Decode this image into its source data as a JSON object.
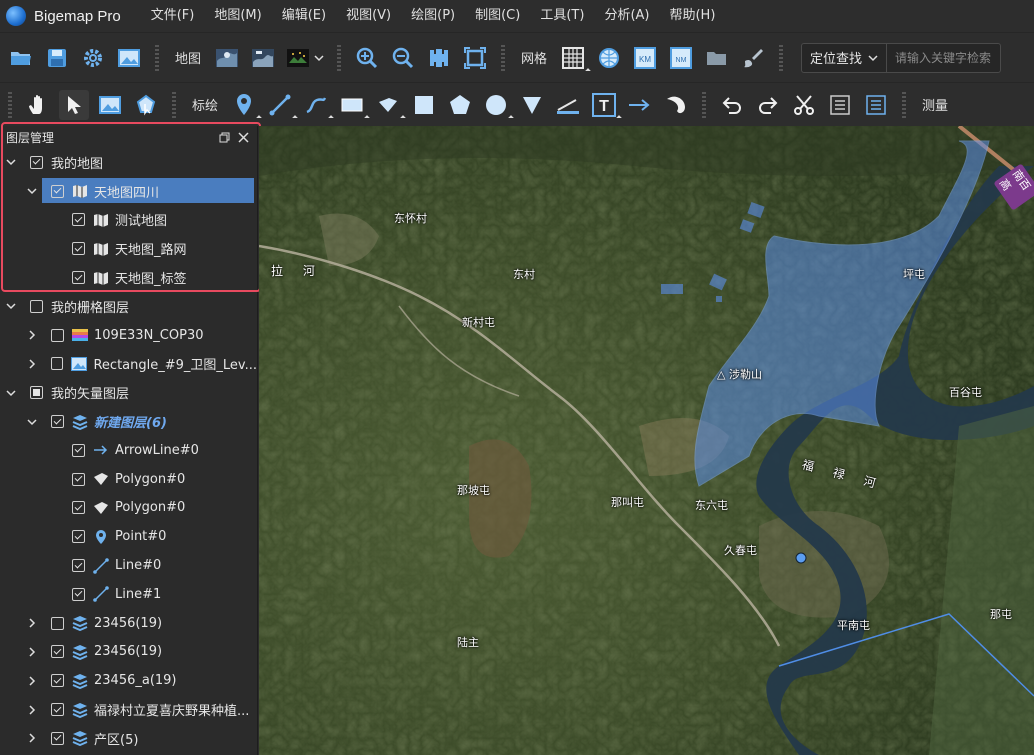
{
  "app": {
    "title": "Bigemap Pro"
  },
  "menu": [
    "文件(F)",
    "地图(M)",
    "编辑(E)",
    "视图(V)",
    "绘图(P)",
    "制图(C)",
    "工具(T)",
    "分析(A)",
    "帮助(H)"
  ],
  "toolbar1": {
    "map_label": "地图",
    "grid_label": "网格",
    "search": {
      "mode": "定位查找",
      "placeholder": "请输入关键字检索"
    },
    "icons": [
      "open-folder-icon",
      "save-icon",
      "settings-gear-icon",
      "image-export-icon",
      "map-source-1-icon",
      "map-source-2-icon",
      "map-source-3-icon",
      "zoom-in-icon",
      "zoom-out-icon",
      "zoom-extent-icon",
      "full-extent-icon",
      "grid-icon",
      "utm-grid-icon",
      "km-grid-icon",
      "nm-grid-icon",
      "folder-gray-icon",
      "brush-icon"
    ]
  },
  "toolbar2": {
    "annotate_label": "标绘",
    "measure_label": "测量",
    "icons": [
      "pan-hand-icon",
      "select-arrow-icon",
      "image-select-icon",
      "polygon-select-icon",
      "marker-icon",
      "line-icon",
      "curve-icon",
      "rectangle-icon",
      "polygon-icon",
      "square-icon",
      "pentagon-icon",
      "circle-icon",
      "triangle-icon",
      "ruler-icon",
      "text-icon",
      "arrow-icon",
      "cut-shape-icon",
      "undo-icon",
      "redo-icon",
      "scissors-icon",
      "properties-icon",
      "list-icon"
    ]
  },
  "panel": {
    "title": "图层管理",
    "rows": [
      {
        "label": "我的地图",
        "indent": 0,
        "chevron": "down",
        "check": "checked",
        "icon": "none"
      },
      {
        "label": "天地图四川",
        "indent": 1,
        "chevron": "down",
        "check": "checked",
        "icon": "map",
        "selected": true
      },
      {
        "label": "测试地图",
        "indent": 2,
        "chevron": "none",
        "check": "checked",
        "icon": "map"
      },
      {
        "label": "天地图_路网",
        "indent": 2,
        "chevron": "none",
        "check": "checked",
        "icon": "map"
      },
      {
        "label": "天地图_标签",
        "indent": 2,
        "chevron": "none",
        "check": "checked",
        "icon": "map"
      },
      {
        "label": "我的栅格图层",
        "indent": 0,
        "chevron": "down",
        "check": "unchecked",
        "icon": "none"
      },
      {
        "label": "109E33N_COP30",
        "indent": 1,
        "chevron": "right",
        "check": "unchecked",
        "icon": "rainbow"
      },
      {
        "label": "Rectangle_#9_卫图_Lev...",
        "indent": 1,
        "chevron": "right",
        "check": "unchecked",
        "icon": "image"
      },
      {
        "label": "我的矢量图层",
        "indent": 0,
        "chevron": "down",
        "check": "partial",
        "icon": "none"
      },
      {
        "label": "新建图层(6)",
        "indent": 1,
        "chevron": "down",
        "check": "checked",
        "icon": "layers",
        "italic": true
      },
      {
        "label": "ArrowLine#0",
        "indent": 2,
        "chevron": "none",
        "check": "checked",
        "icon": "arrow"
      },
      {
        "label": "Polygon#0",
        "indent": 2,
        "chevron": "none",
        "check": "checked",
        "icon": "polygon"
      },
      {
        "label": "Polygon#0",
        "indent": 2,
        "chevron": "none",
        "check": "checked",
        "icon": "polygon"
      },
      {
        "label": "Point#0",
        "indent": 2,
        "chevron": "none",
        "check": "checked",
        "icon": "point"
      },
      {
        "label": "Line#0",
        "indent": 2,
        "chevron": "none",
        "check": "checked",
        "icon": "line"
      },
      {
        "label": "Line#1",
        "indent": 2,
        "chevron": "none",
        "check": "checked",
        "icon": "line"
      },
      {
        "label": "23456(19)",
        "indent": 1,
        "chevron": "right",
        "check": "unchecked",
        "icon": "layers"
      },
      {
        "label": "23456(19)",
        "indent": 1,
        "chevron": "right",
        "check": "checked",
        "icon": "layers"
      },
      {
        "label": "23456_a(19)",
        "indent": 1,
        "chevron": "right",
        "check": "checked",
        "icon": "layers"
      },
      {
        "label": "福禄村立夏喜庆野果种植...",
        "indent": 1,
        "chevron": "right",
        "check": "checked",
        "icon": "layers"
      },
      {
        "label": "产区(5)",
        "indent": 1,
        "chevron": "right",
        "check": "checked",
        "icon": "layers"
      }
    ]
  },
  "map": {
    "labels": {
      "dongwai": "东怀村",
      "donghui": "东村",
      "xincun": "新村屯",
      "lahe": "拉  河",
      "shelei": "△ 涉勒山",
      "fulu": "福 禄 河",
      "nashan": "那坡屯",
      "najiao": "那叫屯",
      "dongliu": "东六屯",
      "jiuxi": "久春屯",
      "pingtun": "坪屯",
      "baigu": "百谷屯",
      "luzhu": "陆主",
      "pinnan": "平南屯",
      "natun": "那屯",
      "road": "南百高"
    }
  },
  "colors": {
    "accent": "#4a7dbf",
    "highlight": "#e84a5f",
    "polygon_fill": "#5b8ee8"
  }
}
